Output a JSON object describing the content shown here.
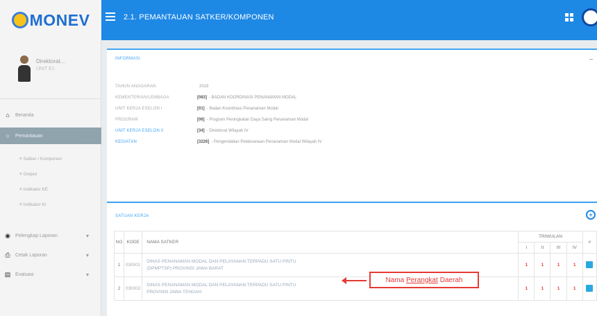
{
  "app": {
    "logo_text": "MONEV",
    "page_title": "2.1. PEMANTAUAN SATKER/KOMPONEN"
  },
  "colors": {
    "header_blue": "#1e88e5",
    "accent_red": "#e53935",
    "sidebar_active": "#90a4ae"
  },
  "sidebar": {
    "profile_name": "Direktorat...",
    "profile_role": "UNIT E1",
    "items": [
      {
        "label": "Beranda",
        "icon": "home-icon"
      },
      {
        "label": "Pemantauan",
        "icon": "circle-icon",
        "active": true
      },
      {
        "label": "Pelengkap Laporan",
        "icon": "binoculars-icon",
        "has_chevron": true
      },
      {
        "label": "Cetak Laporan",
        "icon": "printer-icon",
        "has_chevron": true
      },
      {
        "label": "Evaluasi",
        "icon": "chart-icon",
        "has_chevron": true
      }
    ],
    "subitems": [
      "Satker / Komponen",
      "Output",
      "Indikator KE",
      "Indikator KI"
    ]
  },
  "info": {
    "title": "INFORMASI",
    "rows": [
      {
        "label": "TAHUN ANGGARAN",
        "code": "",
        "value": "2019",
        "label_blue": false
      },
      {
        "label": "KEMENTERIAN/LEMBAGA",
        "code": "[083]",
        "value": "- BADAN KOORDINASI PENANAMAN MODAL",
        "label_blue": false
      },
      {
        "label": "UNIT KERJA ESELON I",
        "code": "[01]",
        "value": "- Badan Koordinasi Penanaman Modal",
        "label_blue": false
      },
      {
        "label": "PROGRAM",
        "code": "[06]",
        "value": "- Program Peningkatan Daya Saing Penanaman Modal",
        "label_blue": false
      },
      {
        "label": "UNIT KERJA ESELON II",
        "code": "[34]",
        "value": "- Direktorat Wilayah IV",
        "label_blue": true
      },
      {
        "label": "KEGIATAN",
        "code": "[3226]",
        "value": "- Pengendalian Pelaksanaan Penanaman Modal Wilayah IV",
        "label_blue": true
      }
    ]
  },
  "satker": {
    "title": "SATUAN KERJA",
    "headers": {
      "no": "NO",
      "kode": "KODE",
      "nama": "NAMA SATKER",
      "triwulan": "TRIWULAN",
      "tw": [
        "I",
        "II",
        "III",
        "IV"
      ],
      "action": "#"
    },
    "rows": [
      {
        "no": "1",
        "kode": "030001",
        "nama_line1": "DINAS PENANAMAN MODAL DAN PELAYANAN TERPADU SATU PINTU",
        "nama_line2": "(DPMPTSP) PROVINSI JAWA BARAT",
        "tw": [
          "1",
          "1",
          "1",
          "1"
        ]
      },
      {
        "no": "2",
        "kode": "030002",
        "nama_line1": "DINAS PENANAMAN MODAL DAN PELAYANAN TERPADU SATU PINTU",
        "nama_line2": "PROVINSI JAWA TENGAH",
        "tw": [
          "1",
          "1",
          "1",
          "1"
        ]
      }
    ]
  },
  "annotation": {
    "pre": "Nama",
    "underlined": "Perangkat",
    "post": "Daerah"
  }
}
